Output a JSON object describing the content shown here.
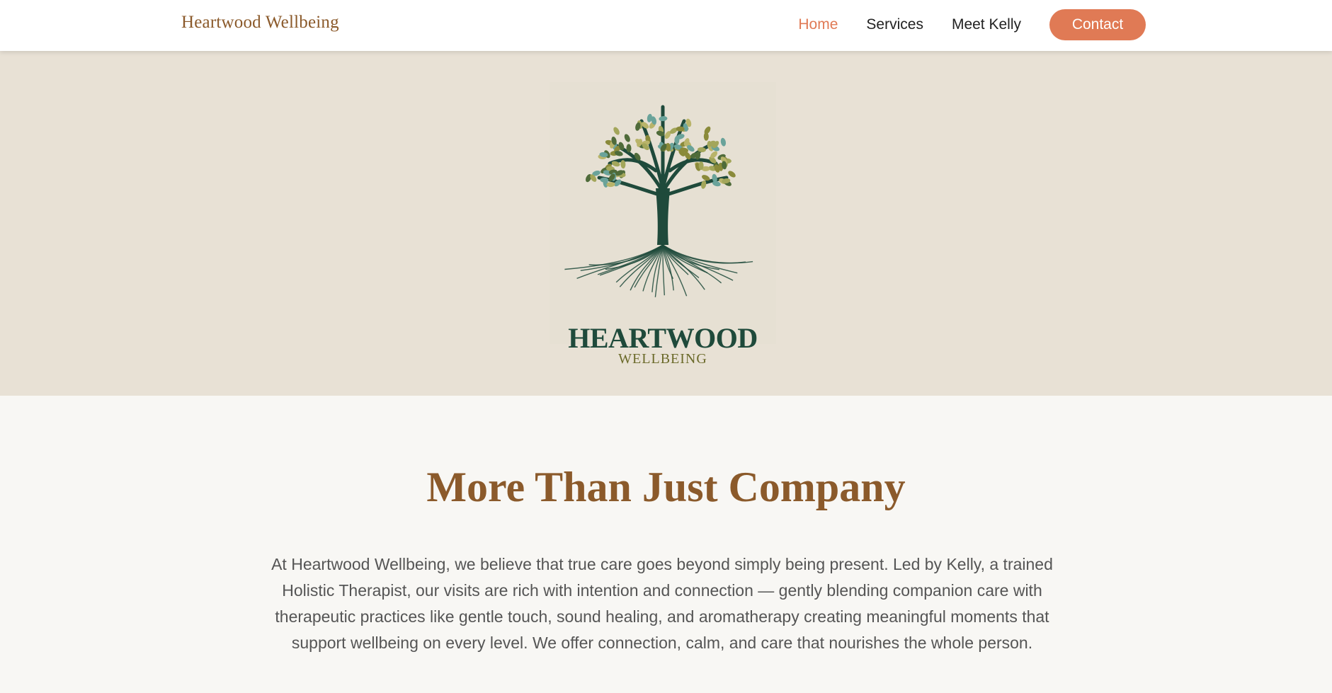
{
  "nav": {
    "brand": "Heartwood Wellbeing",
    "links": [
      {
        "label": "Home",
        "active": true
      },
      {
        "label": "Services",
        "active": false
      },
      {
        "label": "Meet Kelly",
        "active": false
      }
    ],
    "contact_label": "Contact"
  },
  "hero": {
    "logo_title": "HEARTWOOD",
    "logo_subtitle": "WELLBEING",
    "logo_icon": "tree-of-life-icon"
  },
  "about": {
    "heading": "More Than Just Company",
    "body": "At Heartwood Wellbeing, we believe that true care goes beyond simply being present. Led by Kelly, a trained Holistic Therapist, our visits are rich with intention and connection — gently blending companion care with therapeutic practices like gentle touch, sound healing, and aromatherapy creating meaningful moments that support wellbeing on every level. We offer connection, calm, and care that nourishes the whole person."
  },
  "colors": {
    "accent": "#e07a55",
    "brand_brown": "#8b5a2b",
    "hero_bg": "#e8e1d5",
    "tree_green": "#1f4a3b",
    "leaf_olive": "#8a8a3a",
    "leaf_teal": "#6aa39a"
  }
}
